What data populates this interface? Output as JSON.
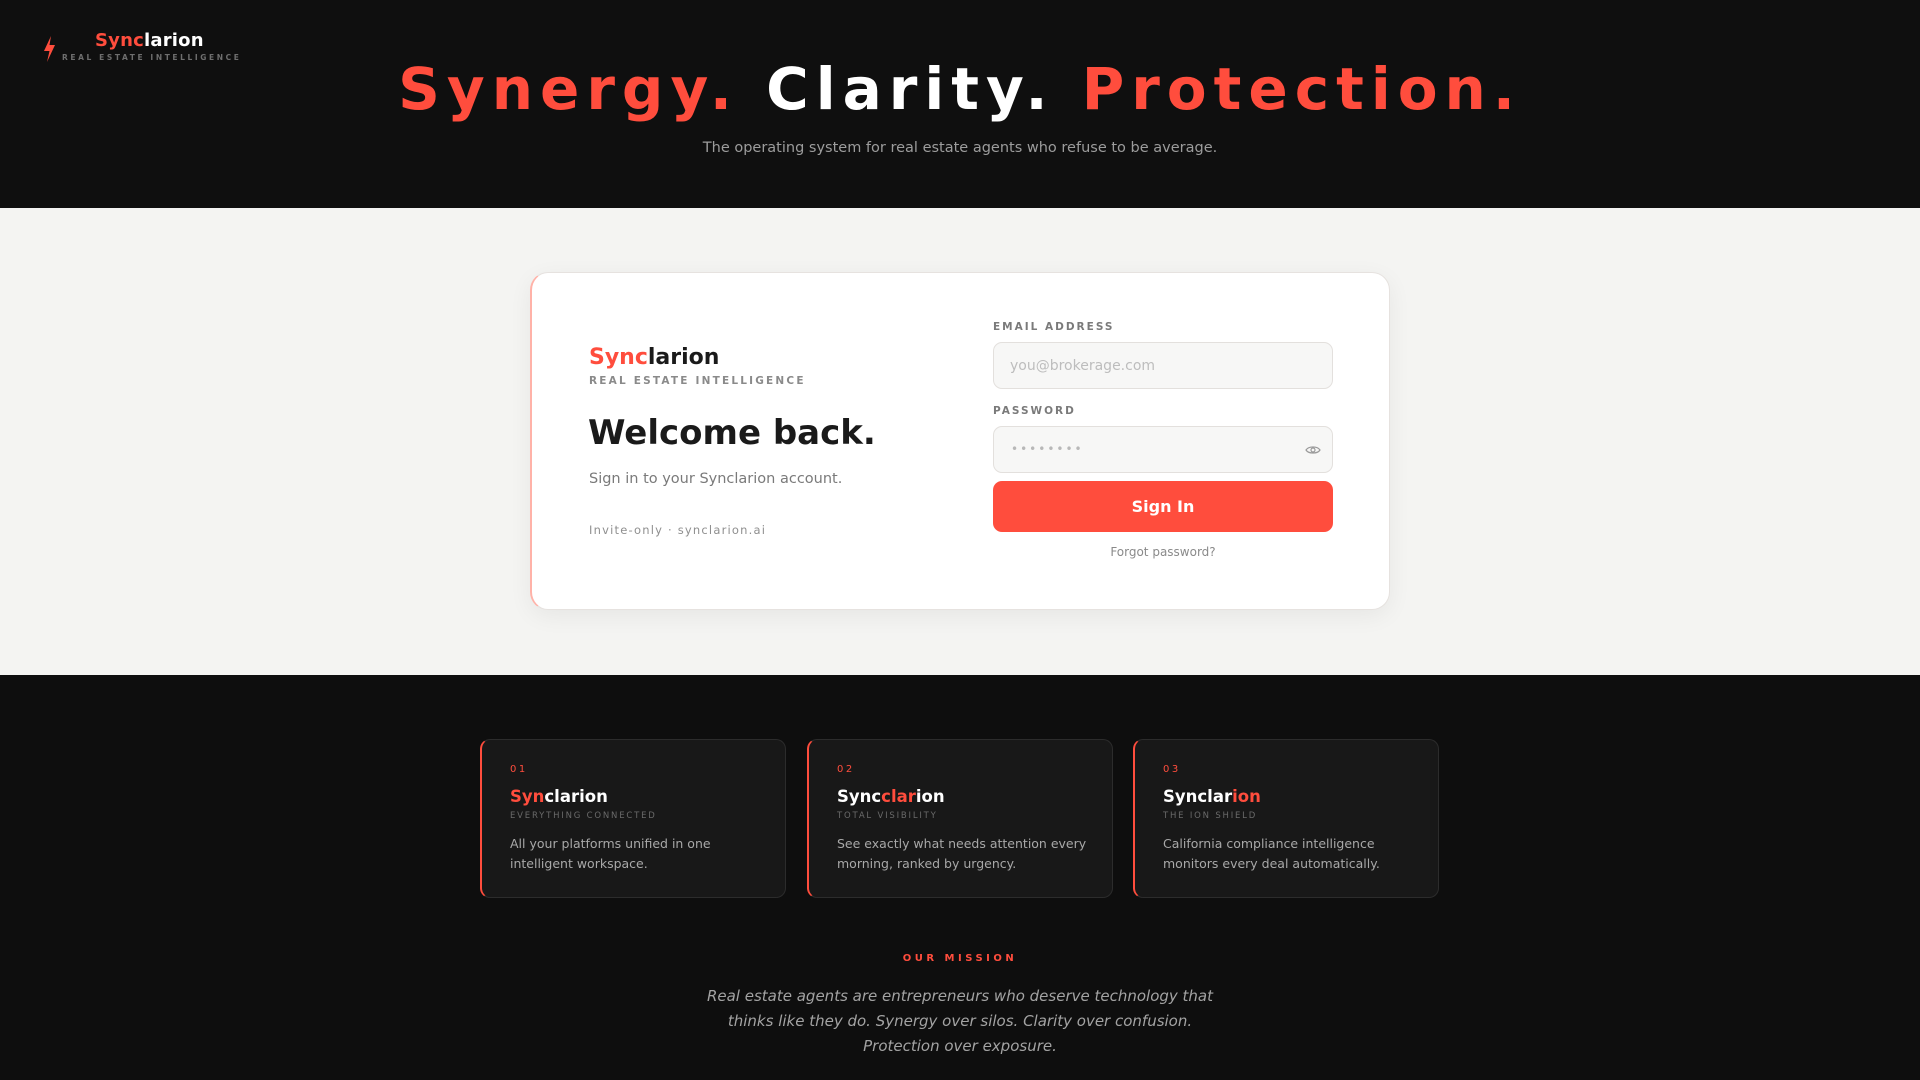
{
  "brand": {
    "name_part1": "Sync",
    "name_part2": "larion",
    "tagline": "REAL ESTATE INTELLIGENCE"
  },
  "hero": {
    "word1": "Synergy.",
    "word2": "Clarity.",
    "word3": "Protection.",
    "subtitle": "The operating system for real estate agents who refuse to be average."
  },
  "login": {
    "brand_part1": "Sync",
    "brand_part2": "larion",
    "brand_sub": "REAL ESTATE INTELLIGENCE",
    "heading": "Welcome back.",
    "subheading": "Sign in to your Synclarion account.",
    "footnote": "Invite-only · synclarion.ai",
    "email_label": "EMAIL ADDRESS",
    "email_placeholder": "you@brokerage.com",
    "email_value": "",
    "password_label": "PASSWORD",
    "password_mask": "••••••••",
    "signin_label": "Sign In",
    "forgot_label": "Forgot password?"
  },
  "features": [
    {
      "num": "01",
      "name_a": "Syn",
      "name_b": "clarion",
      "name_c": "",
      "tag": "EVERYTHING CONNECTED",
      "desc": "All your platforms unified in one intelligent workspace."
    },
    {
      "num": "02",
      "name_a": "Sync",
      "name_b": "clar",
      "name_c": "ion",
      "tag": "TOTAL VISIBILITY",
      "desc": "See exactly what needs attention every morning, ranked by urgency."
    },
    {
      "num": "03",
      "name_a": "Synclar",
      "name_b": "ion",
      "name_c": "",
      "tag": "THE ION SHIELD",
      "desc": "California compliance intelligence monitors every deal automatically."
    }
  ],
  "mission": {
    "label": "OUR MISSION",
    "text": "Real estate agents are entrepreneurs who deserve technology that thinks like they do. Synergy over silos. Clarity over confusion. Protection over exposure."
  },
  "colors": {
    "accent": "#ff4d3d",
    "dark_bg": "#0f0f0f",
    "light_bg": "#f4f4f2",
    "card_bg": "#181818"
  },
  "icons": {
    "logo": "lightning-bolt-icon",
    "password_toggle": "eye-icon"
  }
}
